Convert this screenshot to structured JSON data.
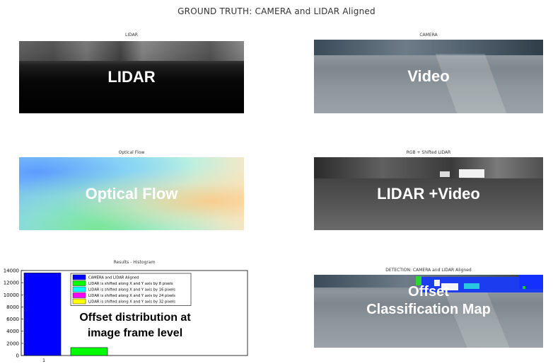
{
  "title": "GROUND TRUTH: CAMERA and LIDAR Aligned",
  "panels": {
    "lidar": {
      "caption": "LIDAR",
      "overlay": "LIDAR"
    },
    "camera": {
      "caption": "CAMERA",
      "overlay": "Video"
    },
    "flow": {
      "caption": "Optical Flow",
      "overlay": "Optical Flow"
    },
    "fused": {
      "caption": "RGB + Shifted LIDAR",
      "overlay": "LIDAR +Video"
    },
    "histogram": {
      "caption": "Results - Histogram",
      "overlay_line1": "Offset distribution at",
      "overlay_line2": "image frame level"
    },
    "detection": {
      "caption": "DETECTION: CAMERA and LIDAR Aligned",
      "overlay_line1": "Offset",
      "overlay_line2": "Classification Map"
    }
  },
  "colors": {
    "aligned": "#0000ff",
    "shift8": "#00ff00",
    "shift16": "#00ffff",
    "shift24": "#ff00ff",
    "shift32": "#ffff00"
  },
  "chart_data": {
    "type": "bar",
    "title": "Results - Histogram",
    "categories": [
      "1"
    ],
    "ylim": [
      0,
      14000
    ],
    "yticks": [
      "0",
      "2000",
      "4000",
      "6000",
      "8000",
      "10000",
      "12000",
      "14000"
    ],
    "series": [
      {
        "name": "CAMERA and LIDAR Aligned",
        "color": "#0000ff",
        "value": 13600
      },
      {
        "name": "LIDAR is shifted along X and Y axis by 8 pixels",
        "color": "#00ff00",
        "value": 1300
      },
      {
        "name": "LIDAR is shifted along X and Y axis by 16 pixels",
        "color": "#00ffff",
        "value": 0
      },
      {
        "name": "LIDAR is shifted along X and Y axis by 24 pixels",
        "color": "#ff00ff",
        "value": 0
      },
      {
        "name": "LIDAR is shifted along X and Y axis by 32 pixels",
        "color": "#ffff00",
        "value": 0
      }
    ],
    "legend_position": "top-right",
    "grid": false
  }
}
